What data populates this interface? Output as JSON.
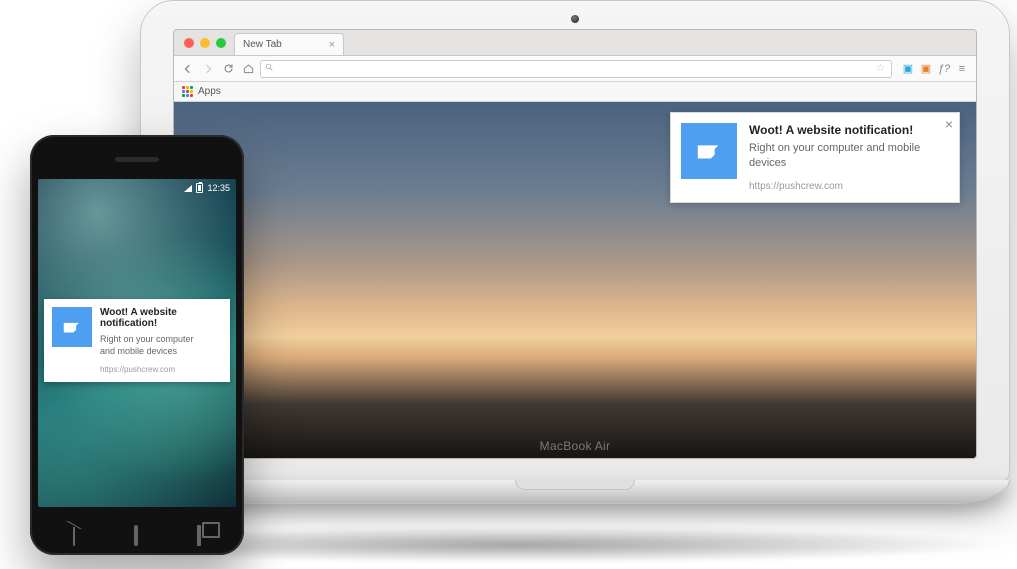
{
  "browser": {
    "tab_label": "New Tab",
    "address_placeholder": "",
    "apps_label": "Apps"
  },
  "laptop": {
    "model_label": "MacBook Air"
  },
  "phone": {
    "status_time": "12:35"
  },
  "notification": {
    "title": "Woot! A website notification!",
    "body": "Right on your computer and mobile devices",
    "source": "https://pushcrew.com"
  },
  "colors": {
    "notif_accent": "#4e9ef1"
  }
}
